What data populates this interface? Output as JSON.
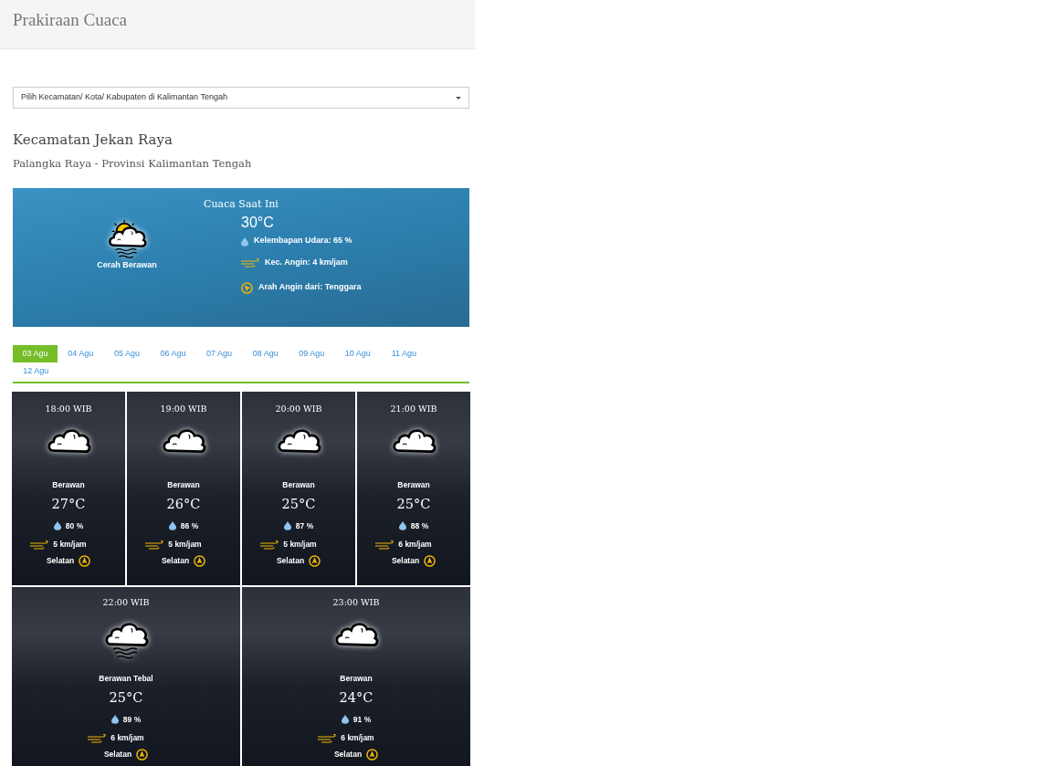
{
  "header": {
    "title": "Prakiraan Cuaca"
  },
  "location_select": {
    "value": "Pilih Kecamatan/ Kota/ Kabupaten di Kalimantan Tengah"
  },
  "location": {
    "title": "Kecamatan Jekan Raya",
    "subtitle": "Palangka Raya - Provinsi Kalimantan Tengah"
  },
  "current": {
    "heading": "Cuaca Saat Ini",
    "kind": "sun-cloud-fog",
    "condition": "Cerah Berawan",
    "temperature": "30°C",
    "humidity": "Kelembapan Udara: 65 %",
    "wind_speed": "Kec. Angin: 4 km/jam",
    "wind_direction": "Arah Angin dari: Tenggara"
  },
  "dates": [
    {
      "label": "03 Agu",
      "selected": true
    },
    {
      "label": "04 Agu",
      "selected": false
    },
    {
      "label": "05 Agu",
      "selected": false
    },
    {
      "label": "06 Agu",
      "selected": false
    },
    {
      "label": "07 Agu",
      "selected": false
    },
    {
      "label": "08 Agu",
      "selected": false
    },
    {
      "label": "09 Agu",
      "selected": false
    },
    {
      "label": "10 Agu",
      "selected": false
    },
    {
      "label": "11 Agu",
      "selected": false
    },
    {
      "label": "12 Agu",
      "selected": false
    }
  ],
  "forecast": [
    {
      "time": "18:00 WIB",
      "kind": "cloud",
      "condition": "Berawan",
      "temperature": "27°C",
      "humidity": "80 %",
      "wind_speed": "5 km/jam",
      "wind_direction": "Selatan"
    },
    {
      "time": "19:00 WIB",
      "kind": "cloud",
      "condition": "Berawan",
      "temperature": "26°C",
      "humidity": "86 %",
      "wind_speed": "5 km/jam",
      "wind_direction": "Selatan"
    },
    {
      "time": "20:00 WIB",
      "kind": "cloud",
      "condition": "Berawan",
      "temperature": "25°C",
      "humidity": "87 %",
      "wind_speed": "5 km/jam",
      "wind_direction": "Selatan"
    },
    {
      "time": "21:00 WIB",
      "kind": "cloud",
      "condition": "Berawan",
      "temperature": "25°C",
      "humidity": "88 %",
      "wind_speed": "6 km/jam",
      "wind_direction": "Selatan"
    },
    {
      "time": "22:00 WIB",
      "kind": "cloud-fog",
      "condition": "Berawan Tebal",
      "temperature": "25°C",
      "humidity": "89 %",
      "wind_speed": "6 km/jam",
      "wind_direction": "Selatan"
    },
    {
      "time": "23:00 WIB",
      "kind": "cloud",
      "condition": "Berawan",
      "temperature": "24°C",
      "humidity": "91 %",
      "wind_speed": "6 km/jam",
      "wind_direction": "Selatan"
    }
  ]
}
